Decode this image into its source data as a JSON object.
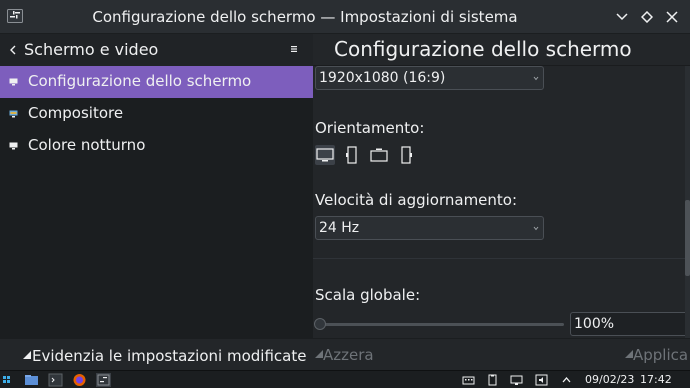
{
  "window": {
    "title": "Configurazione dello schermo — Impostazioni di sistema"
  },
  "sidebar": {
    "title": "Schermo e video",
    "items": [
      {
        "label": "Configurazione dello schermo",
        "active": true
      },
      {
        "label": "Compositore",
        "active": false
      },
      {
        "label": "Colore notturno",
        "active": false
      }
    ]
  },
  "main": {
    "title": "Configurazione dello schermo",
    "resolution": {
      "value": "1920x1080 (16:9)"
    },
    "orientation": {
      "label": "Orientamento:",
      "options": [
        "landscape",
        "portrait",
        "inverted-landscape",
        "inverted-portrait"
      ],
      "selected": "landscape"
    },
    "refresh": {
      "label": "Velocità di aggiornamento:",
      "value": "24 Hz"
    },
    "scale": {
      "label": "Scala globale:",
      "value": "100%",
      "slider_fraction": 0
    }
  },
  "footer": {
    "highlight_label": "Evidenzia le impostazioni modificate",
    "reset_label": "Azzera",
    "apply_label": "Applica"
  },
  "taskbar": {
    "date": "09/02/23",
    "time": "17:42"
  },
  "colors": {
    "accent": "#7d5ebd",
    "background": "#232629",
    "sidebar": "#1b1e20",
    "text": "#eff0f1"
  }
}
